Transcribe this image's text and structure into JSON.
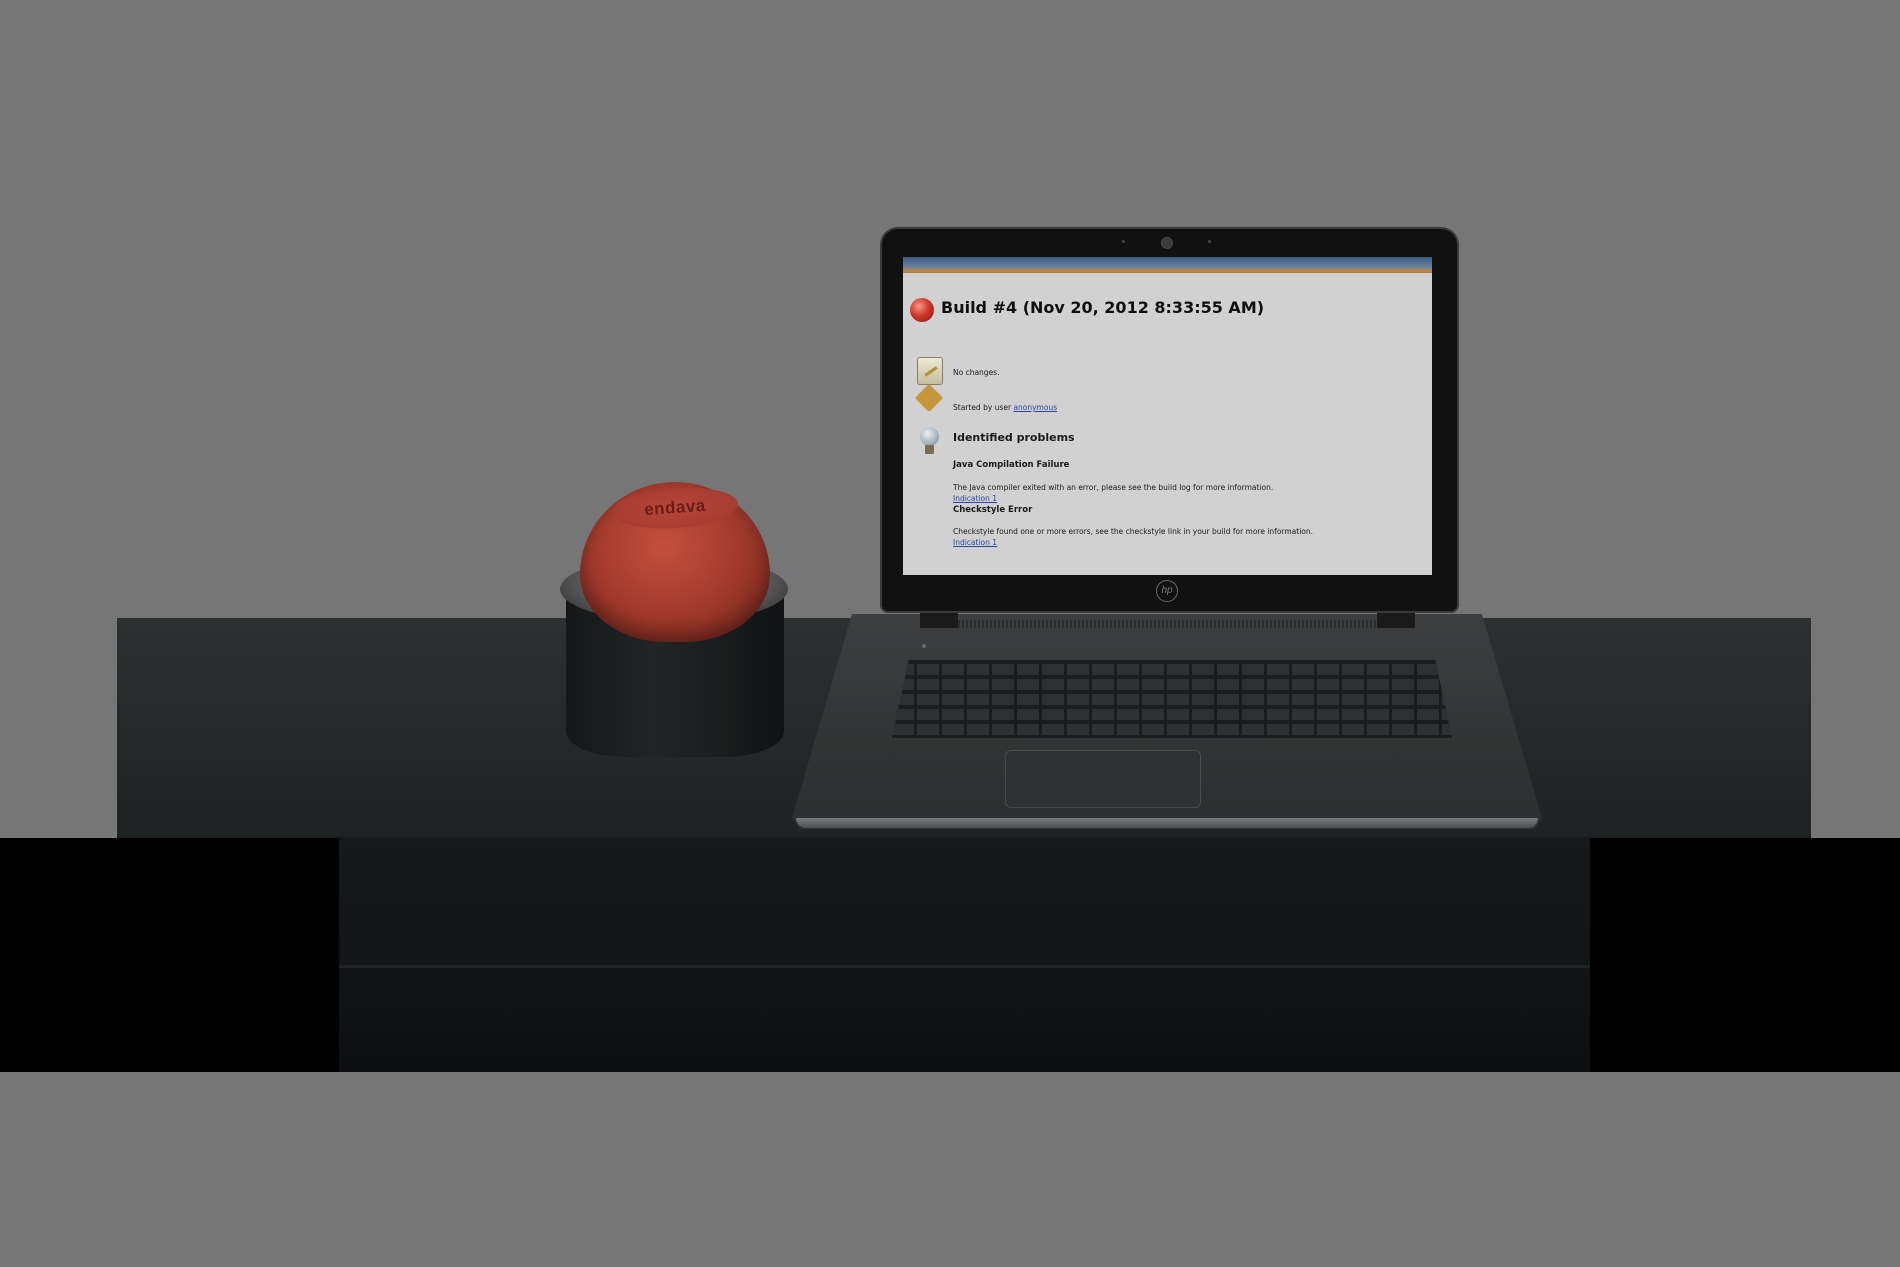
{
  "screen": {
    "build_title": "Build #4 (Nov 20, 2012 8:33:55 AM)",
    "no_changes": "No changes.",
    "started_by_prefix": "Started by user ",
    "started_by_user": "anonymous",
    "problems_heading": "Identified problems",
    "problems": [
      {
        "title": "Java Compilation Failure",
        "description": "The Java compiler exited with an error, please see the build log for more information.",
        "link": "Indication 1"
      },
      {
        "title": "Checkstyle Error",
        "description": "Checkstyle found one or more errors, see the checkstyle link in your build for more information.",
        "link": "Indication 1"
      }
    ],
    "status_icon": "red-ball-icon",
    "icons": [
      "notepad-icon",
      "user-icon",
      "lightbulb-icon"
    ]
  },
  "lamp": {
    "logo_text": "endava",
    "state_color": "#b0402f"
  },
  "laptop": {
    "brand_logo": "hp"
  },
  "colors": {
    "background": "#767676",
    "desk": "#2a2d2e",
    "status_failed": "#d53a2d",
    "link": "#2a46a8"
  }
}
